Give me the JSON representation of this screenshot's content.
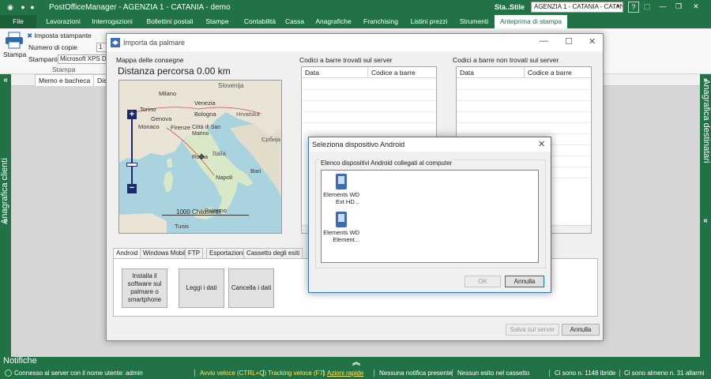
{
  "app": {
    "title": "PostOfficeManager - AGENZIA 1 - CATANIA - demo",
    "status_label": "Sta...",
    "style_label": "Stile",
    "agency_combo": "AGENZIA 1 - CATANIA - CATANIA"
  },
  "ribbon_tabs": [
    {
      "label": "File"
    },
    {
      "label": "Lavorazioni"
    },
    {
      "label": "Interrogazioni"
    },
    {
      "label": "Bollettini postali"
    },
    {
      "label": "Stampe"
    },
    {
      "label": "Contabilità"
    },
    {
      "label": "Cassa"
    },
    {
      "label": "Anagrafiche"
    },
    {
      "label": "Franchising"
    },
    {
      "label": "Listini prezzi"
    },
    {
      "label": "Strumenti"
    },
    {
      "label": "Anteprima di stampa"
    }
  ],
  "ribbon": {
    "stampa_big": "Stampa",
    "imposta_stampante": "Imposta stampante",
    "numero_copie_label": "Numero di copie",
    "numero_copie_value": "1",
    "stampante_label": "Stampante",
    "stampante_value": "Microsoft XPS Doc",
    "group_label": "Stampa"
  },
  "side_panels": {
    "left": "Anagrafica clienti",
    "right": "Anagrafica destinatari"
  },
  "doc_tabs": [
    {
      "label": "Memo e bacheca"
    },
    {
      "label": "Dis"
    }
  ],
  "main_dialog": {
    "title": "Importa da palmare",
    "map_label": "Mappa delle consegne",
    "distance": "Distanza percorsa 0.00 km",
    "scale": "1000 Chilometri",
    "found_label": "Codici a barre trovati sul server",
    "not_found_label": "Codici a barre non trovati sul server",
    "col_data": "Data",
    "col_barcode": "Codice a barre",
    "tabs": [
      {
        "label": "Android"
      },
      {
        "label": "Windows Mobile"
      },
      {
        "label": "FTP"
      },
      {
        "label": "Esportazioni"
      },
      {
        "label": "Cassetto degli esiti"
      }
    ],
    "btn_install": "Installa il software sul palmare o smartphone",
    "btn_read": "Leggi i dati",
    "btn_delete": "Cancella i dati",
    "btn_save": "Salva sul server",
    "btn_cancel": "Annulla"
  },
  "map_labels": [
    {
      "text": "Slovenija"
    },
    {
      "text": "Milano"
    },
    {
      "text": "Venezia"
    },
    {
      "text": "Hrvatska"
    },
    {
      "text": "Torino"
    },
    {
      "text": "Genova"
    },
    {
      "text": "Bologna"
    },
    {
      "text": "Monaco"
    },
    {
      "text": "Firenze"
    },
    {
      "text": "Città di San Marino"
    },
    {
      "text": "Србија"
    },
    {
      "text": "Italia"
    },
    {
      "text": "Roma"
    },
    {
      "text": "Bari"
    },
    {
      "text": "Napoli"
    },
    {
      "text": "Palermo"
    },
    {
      "text": "Tunis"
    },
    {
      "text": "Monte..."
    }
  ],
  "android_dialog": {
    "title": "Seleziona dispositivo Android",
    "list_label": "Elenco dispositivi Android collegati al computer",
    "devices": [
      {
        "name": "Elements WD",
        "sub": "Ext HD..."
      },
      {
        "name": "Elements WD",
        "sub": "Element..."
      }
    ],
    "ok": "OK",
    "cancel": "Annulla"
  },
  "notifications": "Notifiche",
  "status": {
    "connected": "Connesso al server con il nome utente: admin",
    "fast_start": "Avvio veloce (CTRL+Q)",
    "tracking": "Tracking veloce (F7)",
    "quick_actions": "Azioni rapide",
    "no_notification": "Nessuna notifica presente",
    "no_outcome": "Nessun esito nel cassetto",
    "hybrid": "Ci sono n. 1148 ibride",
    "unloaded": "Ci sono almeno n. 31 allarmi"
  },
  "colors": {
    "accent": "#217346",
    "highlight": "#ffe46b",
    "dialog_border": "#2b79c2"
  }
}
